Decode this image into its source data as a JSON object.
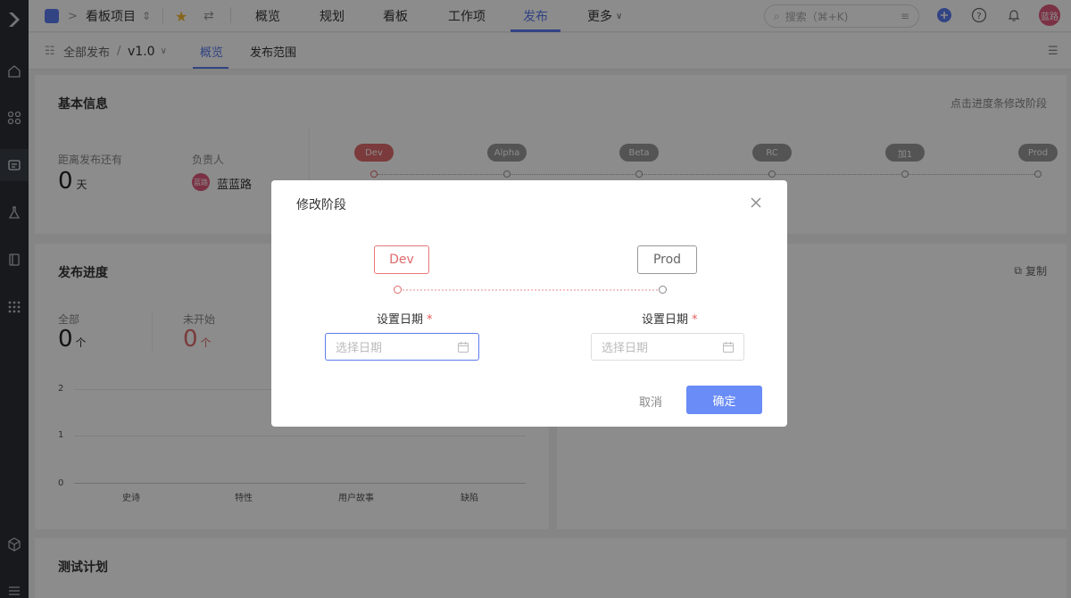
{
  "topbar": {
    "project_name": "看板项目",
    "nav": [
      "概览",
      "规划",
      "看板",
      "工作项",
      "发布",
      "更多"
    ],
    "active_nav": "发布",
    "search_placeholder": "搜索（⌘+K)",
    "avatar_text": "蓝路"
  },
  "subbar": {
    "breadcrumb_root": "全部发布",
    "breadcrumb_sep": "/",
    "version": "v1.0",
    "tabs": [
      "概览",
      "发布范围"
    ],
    "active_tab": "概览"
  },
  "basic_info": {
    "title": "基本信息",
    "hint": "点击进度条修改阶段",
    "countdown_label": "距离发布还有",
    "countdown_value": "0",
    "countdown_unit": "天",
    "owner_label": "负责人",
    "owner_avatar": "蓝路",
    "owner_name": "蓝蓝路",
    "stages": [
      "Dev",
      "Alpha",
      "Beta",
      "RC",
      "加1",
      "Prod"
    ],
    "current_stage": "Dev"
  },
  "progress": {
    "title": "发布进度",
    "copy_label": "复制",
    "all_label": "全部",
    "all_value": "0",
    "all_unit": "个",
    "notstarted_label": "未开始",
    "notstarted_value": "0",
    "notstarted_unit": "个",
    "y_ticks": [
      "2",
      "1",
      "0"
    ],
    "categories": [
      "史诗",
      "特性",
      "用户故事",
      "缺陷"
    ]
  },
  "test_plan": {
    "title": "测试计划"
  },
  "modal": {
    "title": "修改阶段",
    "from_stage": "Dev",
    "to_stage": "Prod",
    "field_label": "设置日期",
    "required_mark": "*",
    "date_placeholder": "选择日期",
    "cancel_label": "取消",
    "ok_label": "确定"
  },
  "colors": {
    "accent": "#5b7cf0",
    "dev_stage": "#e06a6c",
    "ok_button": "#6a8cf7",
    "sidebar": "#2b2f36"
  }
}
